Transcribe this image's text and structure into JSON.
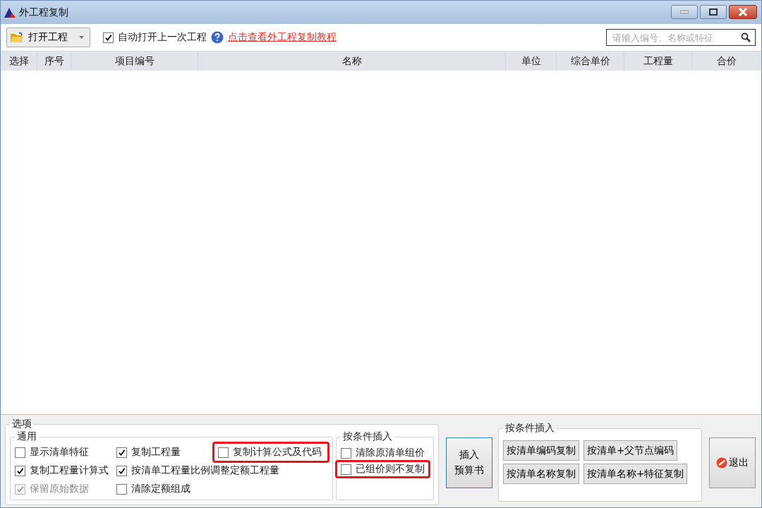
{
  "window": {
    "title": "外工程复制"
  },
  "toolbar": {
    "open_button": "打开工程",
    "auto_open": {
      "label": "自动打开上一次工程",
      "checked": true
    },
    "tutorial_link": "点击查看外工程复制教程",
    "search": {
      "placeholder": "请输入编号、名称或特征"
    }
  },
  "table": {
    "columns": [
      "选择",
      "序号",
      "项目编号",
      "名称",
      "单位",
      "综合单价",
      "工程量",
      "合价"
    ]
  },
  "options": {
    "title": "选项",
    "general": {
      "title": "通用",
      "items": [
        {
          "label": "显示清单特征",
          "checked": false,
          "disabled": false,
          "highlighted": false
        },
        {
          "label": "复制工程量计算式",
          "checked": true,
          "disabled": false,
          "highlighted": false
        },
        {
          "label": "保留原始数据",
          "checked": true,
          "disabled": true,
          "highlighted": false
        },
        {
          "label": "复制工程量",
          "checked": true,
          "disabled": false,
          "highlighted": false
        },
        {
          "label": "按清单工程量比例调整定额工程量",
          "checked": true,
          "disabled": false,
          "highlighted": false
        },
        {
          "label": "清除定额组成",
          "checked": false,
          "disabled": false,
          "highlighted": false
        },
        {
          "label": "复制计算公式及代码",
          "checked": false,
          "disabled": false,
          "highlighted": true
        }
      ]
    },
    "conditional": {
      "title": "按条件插入",
      "items": [
        {
          "label": "清除原清单组价",
          "checked": false,
          "disabled": false,
          "highlighted": false
        },
        {
          "label": "已组价则不复制",
          "checked": false,
          "disabled": false,
          "highlighted": true
        }
      ]
    }
  },
  "insert_button": [
    "插入",
    "预算书"
  ],
  "copy_group": {
    "title": "按条件插入",
    "buttons": [
      "按清单编码复制",
      "按清单+父节点编码",
      "按清单名称复制",
      "按清单名称+特征复制"
    ]
  },
  "exit_button": "退出"
}
